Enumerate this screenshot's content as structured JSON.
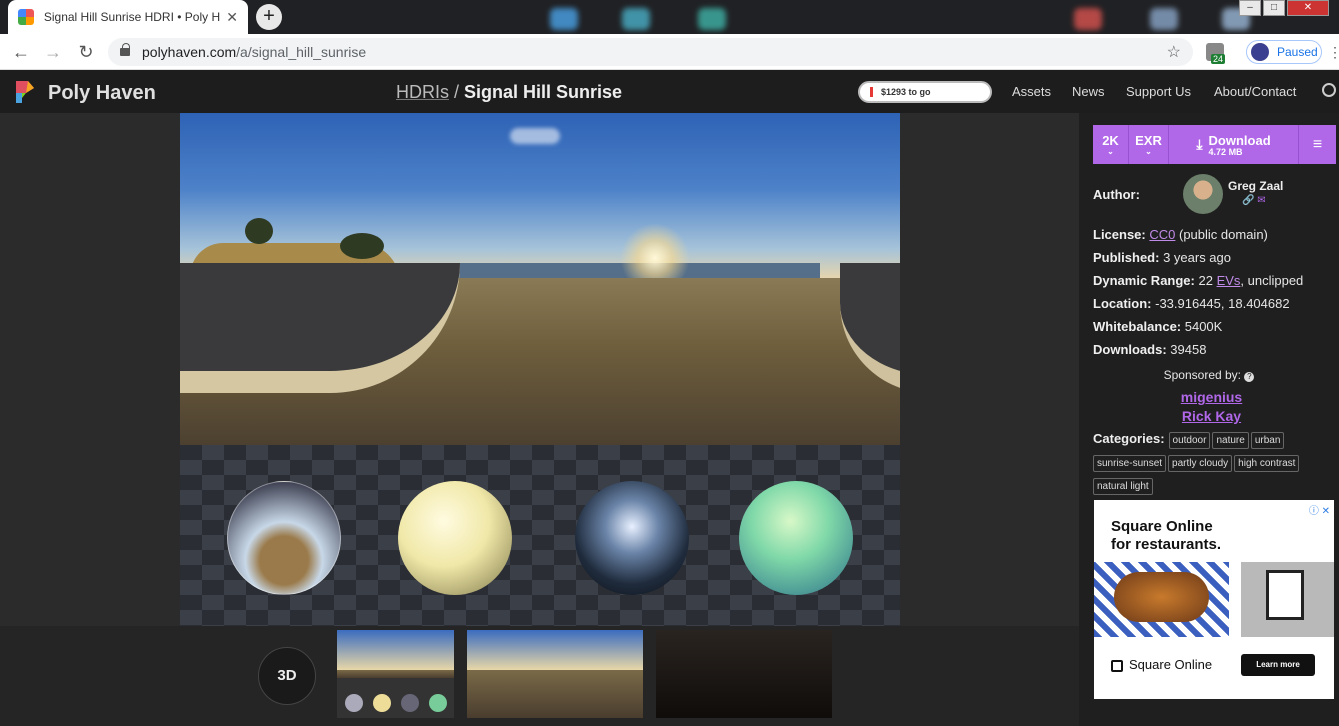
{
  "browser": {
    "tab_title": "Signal Hill Sunrise HDRI • Poly Haven",
    "new_tab": "+",
    "url_host": "polyhaven.com",
    "url_path": "/a/signal_hill_sunrise",
    "extension_badge": "24",
    "profile_status": "Paused"
  },
  "site": {
    "brand": "Poly Haven",
    "breadcrumb_parent": "HDRIs",
    "breadcrumb_sep": " / ",
    "breadcrumb_current": "Signal Hill Sunrise",
    "funding": "$1293 to go",
    "nav": [
      "Assets",
      "News",
      "Support Us",
      "About/Contact"
    ]
  },
  "viewer": {
    "btn_3d": "3D"
  },
  "download": {
    "resolution": "2K",
    "format": "EXR",
    "label": "Download",
    "size": "4.72 MB"
  },
  "info": {
    "author_label": "Author:",
    "author_name": "Greg Zaal",
    "license_label": "License:",
    "license_link": "CC0",
    "license_rest": " (public domain)",
    "published_label": "Published:",
    "published_value": " 3 years ago",
    "range_label": "Dynamic Range:",
    "range_value": " 22 ",
    "range_link": "EVs",
    "range_rest": ", unclipped",
    "location_label": "Location:",
    "location_value": " -33.916445, 18.404682",
    "whitebalance_label": "Whitebalance:",
    "whitebalance_value": " 5400K",
    "downloads_label": "Downloads:",
    "downloads_value": " 39458",
    "sponsored_label": "Sponsored by:",
    "sponsors": [
      "migenius",
      "Rick Kay"
    ],
    "categories_label": "Categories:",
    "categories": [
      "outdoor",
      "nature",
      "urban",
      "sunrise-sunset",
      "partly cloudy",
      "high contrast",
      "natural light"
    ]
  },
  "ad": {
    "headline_1": "Square Online",
    "headline_2": "for restaurants.",
    "brand": "Square Online",
    "cta": "Learn more",
    "corner": "ⓘ ✕"
  },
  "colors": {
    "accent": "#b067e8",
    "header_bg": "#1d1d1d",
    "sidebar_bg": "#1f1f1f"
  }
}
